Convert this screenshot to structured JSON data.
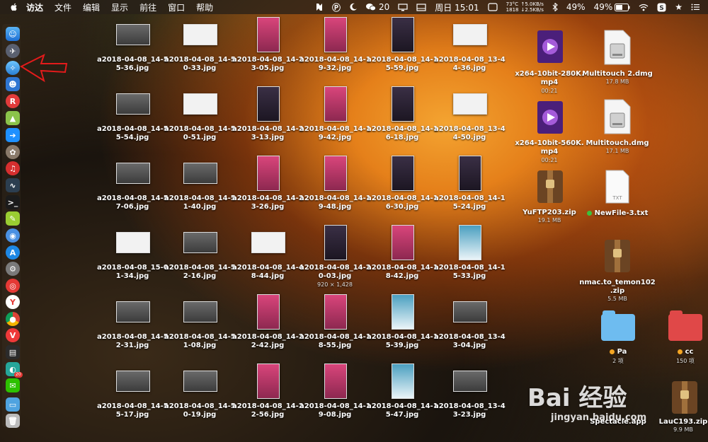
{
  "menubar": {
    "app": "访达",
    "menus": [
      "文件",
      "编辑",
      "显示",
      "前往",
      "窗口",
      "帮助"
    ],
    "status": {
      "wechat_count": "20",
      "clock": "周日 15:01",
      "temp": "73°C",
      "fan": "1818",
      "net_up": "↑5.0KB/s",
      "net_down": "↓2.5KB/s",
      "cpu": "49%",
      "battery": "49%"
    }
  },
  "desktop": {
    "files": [
      {
        "name": "a2018-04-08_14-55-36.jpg",
        "line1": "a2018-04-08_14-5",
        "line2": "5-36.jpg"
      },
      {
        "name": "a2018-04-08_14-50-33.jpg",
        "line1": "a2018-04-08_14-5",
        "line2": "0-33.jpg"
      },
      {
        "name": "a2018-04-08_14-23-05.jpg",
        "line1": "a2018-04-08_14-2",
        "line2": "3-05.jpg"
      },
      {
        "name": "a2018-04-08_14-19-32.jpg",
        "line1": "a2018-04-08_14-1",
        "line2": "9-32.jpg"
      },
      {
        "name": "a2018-04-08_14-15-59.jpg",
        "line1": "a2018-04-08_14-1",
        "line2": "5-59.jpg"
      },
      {
        "name": "a2018-04-08_13-44-36.jpg",
        "line1": "a2018-04-08_13-4",
        "line2": "4-36.jpg"
      },
      {
        "name": "a2018-04-08_14-55-54.jpg",
        "line1": "a2018-04-08_14-5",
        "line2": "5-54.jpg"
      },
      {
        "name": "a2018-04-08_14-50-51.jpg",
        "line1": "a2018-04-08_14-5",
        "line2": "0-51.jpg"
      },
      {
        "name": "a2018-04-08_14-23-13.jpg",
        "line1": "a2018-04-08_14-2",
        "line2": "3-13.jpg"
      },
      {
        "name": "a2018-04-08_14-19-42.jpg",
        "line1": "a2018-04-08_14-1",
        "line2": "9-42.jpg"
      },
      {
        "name": "a2018-04-08_14-16-18.jpg",
        "line1": "a2018-04-08_14-1",
        "line2": "6-18.jpg"
      },
      {
        "name": "a2018-04-08_13-44-50.jpg",
        "line1": "a2018-04-08_13-4",
        "line2": "4-50.jpg"
      },
      {
        "name": "a2018-04-08_14-57-06.jpg",
        "line1": "a2018-04-08_14-5",
        "line2": "7-06.jpg"
      },
      {
        "name": "a2018-04-08_14-51-40.jpg",
        "line1": "a2018-04-08_14-5",
        "line2": "1-40.jpg"
      },
      {
        "name": "a2018-04-08_14-23-26.jpg",
        "line1": "a2018-04-08_14-2",
        "line2": "3-26.jpg"
      },
      {
        "name": "a2018-04-08_14-19-48.jpg",
        "line1": "a2018-04-08_14-1",
        "line2": "9-48.jpg"
      },
      {
        "name": "a2018-04-08_14-16-30.jpg",
        "line1": "a2018-04-08_14-1",
        "line2": "6-30.jpg"
      },
      {
        "name": "a2018-04-08_14-15-24.jpg",
        "line1": "a2018-04-08_14-1",
        "line2": "5-24.jpg"
      },
      {
        "name": "a2018-04-08_15-01-34.jpg",
        "line1": "a2018-04-08_15-0",
        "line2": "1-34.jpg"
      },
      {
        "name": "a2018-04-08_14-52-16.jpg",
        "line1": "a2018-04-08_14-5",
        "line2": "2-16.jpg"
      },
      {
        "name": "a2018-04-08_14-48-44.jpg",
        "line1": "a2018-04-08_14-4",
        "line2": "8-44.jpg"
      },
      {
        "name": "a2018-04-08_14-20-03.jpg",
        "line1": "a2018-04-08_14-2",
        "line2": "0-03.jpg",
        "sub": "920 × 1,428"
      },
      {
        "name": "a2018-04-08_14-18-42.jpg",
        "line1": "a2018-04-08_14-1",
        "line2": "8-42.jpg"
      },
      {
        "name": "a2018-04-08_14-15-33.jpg",
        "line1": "a2018-04-08_14-1",
        "line2": "5-33.jpg"
      },
      {
        "name": "a2018-04-08_14-52-31.jpg",
        "line1": "a2018-04-08_14-5",
        "line2": "2-31.jpg"
      },
      {
        "name": "a2018-04-08_14-51-08.jpg",
        "line1": "a2018-04-08_14-5",
        "line2": "1-08.jpg"
      },
      {
        "name": "a2018-04-08_14-22-42.jpg",
        "line1": "a2018-04-08_14-2",
        "line2": "2-42.jpg"
      },
      {
        "name": "a2018-04-08_14-18-55.jpg",
        "line1": "a2018-04-08_14-1",
        "line2": "8-55.jpg"
      },
      {
        "name": "a2018-04-08_14-15-39.jpg",
        "line1": "a2018-04-08_14-1",
        "line2": "5-39.jpg"
      },
      {
        "name": "a2018-04-08_13-43-04.jpg",
        "line1": "a2018-04-08_13-4",
        "line2": "3-04.jpg"
      },
      {
        "name": "a2018-04-08_14-55-17.jpg",
        "line1": "a2018-04-08_14-5",
        "line2": "5-17.jpg"
      },
      {
        "name": "a2018-04-08_14-50-19.jpg",
        "line1": "a2018-04-08_14-5",
        "line2": "0-19.jpg"
      },
      {
        "name": "a2018-04-08_14-22-56.jpg",
        "line1": "a2018-04-08_14-2",
        "line2": "2-56.jpg"
      },
      {
        "name": "a2018-04-08_14-19-08.jpg",
        "line1": "a2018-04-08_14-1",
        "line2": "9-08.jpg"
      },
      {
        "name": "a2018-04-08_14-15-47.jpg",
        "line1": "a2018-04-08_14-1",
        "line2": "5-47.jpg"
      },
      {
        "name": "a2018-04-08_13-43-23.jpg",
        "line1": "a2018-04-08_13-4",
        "line2": "3-23.jpg"
      }
    ],
    "right_items": {
      "mp4_1": {
        "line1": "x264-10bit-280K.",
        "line2": "mp4",
        "sub": "00:21"
      },
      "mp4_2": {
        "line1": "x264-10bit-560K.",
        "line2": "mp4",
        "sub": "00:21"
      },
      "dmg_1": {
        "line1": "Multitouch 2.dmg",
        "sub": "17.8 MB"
      },
      "dmg_2": {
        "line1": "Multitouch.dmg",
        "sub": "17.1 MB"
      },
      "zip_1": {
        "line1": "YuFTP203.zip",
        "sub": "19.1 MB"
      },
      "txt_1": {
        "line1": "NewFile-3.txt"
      },
      "zip_2": {
        "line1": "nmac.to_temon102",
        "line2": ".zip",
        "sub": "5.5 MB"
      },
      "folder_pa": {
        "line1": "Pa",
        "sub": "2 项"
      },
      "folder_cc": {
        "line1": "cc",
        "sub": "150 项"
      },
      "app_1": {
        "line1": "Spectacle.app"
      },
      "zip_3": {
        "line1": "LauC193.zip",
        "sub": "9.9 MB"
      }
    }
  },
  "dock": {
    "wechat_badge": "20"
  },
  "watermark": {
    "logo": "Bai  经验",
    "url": "jingyan.baidu.com"
  }
}
